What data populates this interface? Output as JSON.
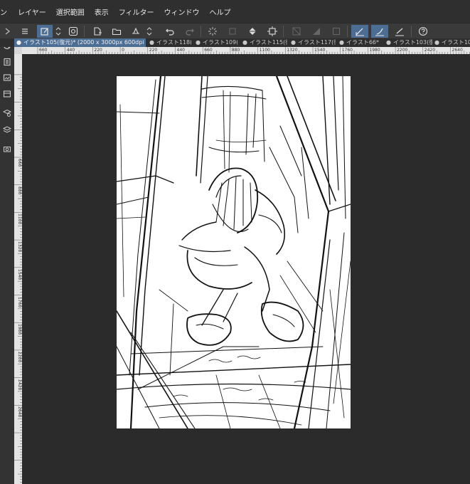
{
  "menubar": {
    "items": [
      "ン",
      "レイヤー",
      "選択範囲",
      "表示",
      "フィルター",
      "ウィンドウ",
      "ヘルプ"
    ]
  },
  "tabs": [
    {
      "label": "イラスト105(復元)* (2000 x 3000px 600dpi 49.5%)",
      "active": true
    },
    {
      "label": "イラスト118(復",
      "active": false
    },
    {
      "label": "イラスト109(復",
      "active": false
    },
    {
      "label": "イラスト115(復",
      "active": false
    },
    {
      "label": "イラスト117(復",
      "active": false
    },
    {
      "label": "イラスト66*",
      "active": false
    },
    {
      "label": "イラスト103(復",
      "active": false
    },
    {
      "label": "イラスト101(",
      "active": false
    }
  ],
  "ruler_top": [
    "660",
    "440",
    "220",
    "0",
    "220",
    "440",
    "660",
    "880",
    "1100",
    "1320",
    "1540",
    "1760",
    "1980",
    "2200",
    "2420",
    "2640",
    "2860"
  ],
  "ruler_left": [
    "660",
    "880",
    "1100",
    "1320",
    "1540",
    "1760",
    "1980",
    "2200",
    "2420",
    "2640"
  ],
  "toolbar_icons": [
    "menu-icon",
    "new-layer-icon",
    "rotate-icon",
    "eye-icon",
    "new-document-icon",
    "open-folder-icon",
    "save-icon",
    "undo-icon",
    "redo-icon",
    "loading-icon",
    "transform-icon",
    "fill-icon",
    "selection-icon",
    "clear-icon",
    "invert-icon",
    "crop-icon",
    "pen-icon",
    "pencil-icon",
    "brush-icon",
    "help-icon"
  ],
  "sidebar_icons": [
    "navigator-icon",
    "layer-property-icon",
    "material-icon",
    "layer-icon",
    "layer-search-icon",
    "stack-icon",
    "camera-icon"
  ]
}
